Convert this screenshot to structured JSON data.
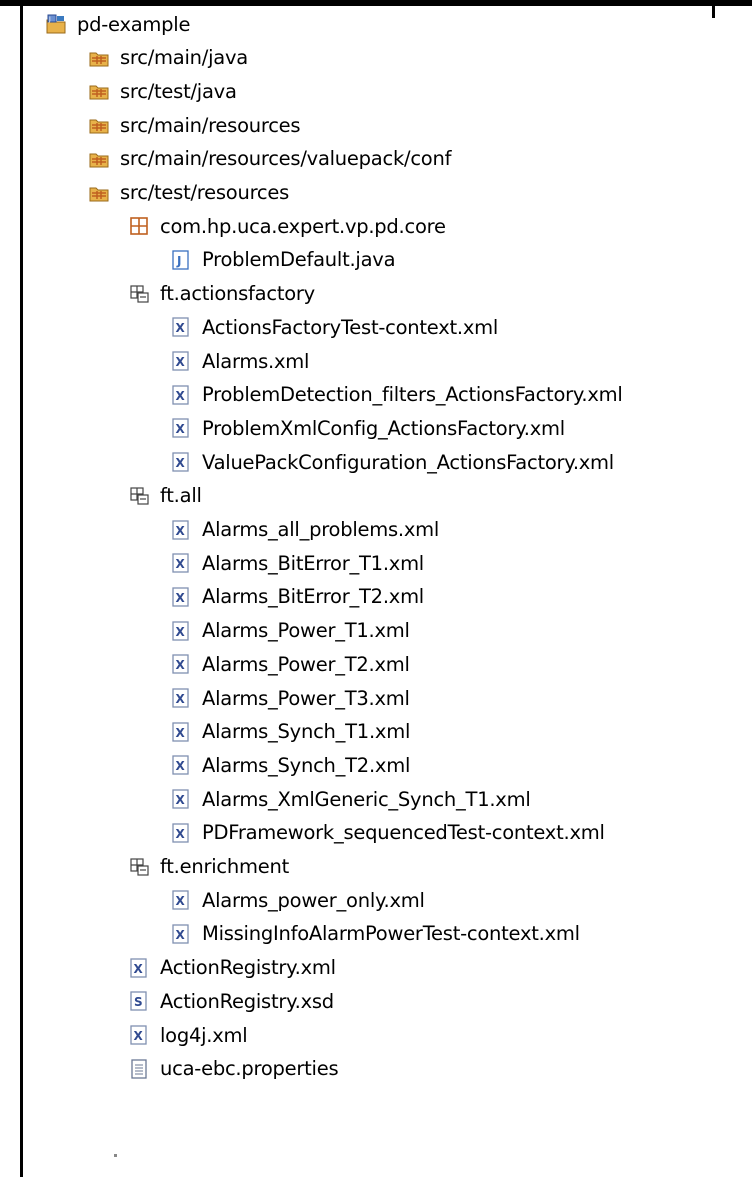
{
  "colors": {
    "folder": "#e8b24a",
    "folder_dark": "#9a6a1a",
    "package": "#c06020",
    "xml_icon": "#304a90",
    "java_icon": "#3a70c0"
  },
  "tree": [
    {
      "label": "pd-example",
      "icon": "project-icon",
      "level": 0
    },
    {
      "label": "src/main/java",
      "icon": "source-folder-icon",
      "level": 1
    },
    {
      "label": "src/test/java",
      "icon": "source-folder-icon",
      "level": 1
    },
    {
      "label": "src/main/resources",
      "icon": "source-folder-icon",
      "level": 1
    },
    {
      "label": "src/main/resources/valuepack/conf",
      "icon": "source-folder-icon",
      "level": 1
    },
    {
      "label": "src/test/resources",
      "icon": "source-folder-icon",
      "level": 1
    },
    {
      "label": "com.hp.uca.expert.vp.pd.core",
      "icon": "package-icon",
      "level": 2
    },
    {
      "label": "ProblemDefault.java",
      "icon": "java-file-icon",
      "level": 3
    },
    {
      "label": "ft.actionsfactory",
      "icon": "folder-package-icon",
      "level": 2
    },
    {
      "label": "ActionsFactoryTest-context.xml",
      "icon": "xml-file-icon",
      "level": 3
    },
    {
      "label": "Alarms.xml",
      "icon": "xml-file-icon",
      "level": 3
    },
    {
      "label": "ProblemDetection_filters_ActionsFactory.xml",
      "icon": "xml-file-icon",
      "level": 3
    },
    {
      "label": "ProblemXmlConfig_ActionsFactory.xml",
      "icon": "xml-file-icon",
      "level": 3
    },
    {
      "label": "ValuePackConfiguration_ActionsFactory.xml",
      "icon": "xml-file-icon",
      "level": 3
    },
    {
      "label": "ft.all",
      "icon": "folder-package-icon",
      "level": 2
    },
    {
      "label": "Alarms_all_problems.xml",
      "icon": "xml-file-icon",
      "level": 3
    },
    {
      "label": "Alarms_BitError_T1.xml",
      "icon": "xml-file-icon",
      "level": 3
    },
    {
      "label": "Alarms_BitError_T2.xml",
      "icon": "xml-file-icon",
      "level": 3
    },
    {
      "label": "Alarms_Power_T1.xml",
      "icon": "xml-file-icon",
      "level": 3
    },
    {
      "label": "Alarms_Power_T2.xml",
      "icon": "xml-file-icon",
      "level": 3
    },
    {
      "label": "Alarms_Power_T3.xml",
      "icon": "xml-file-icon",
      "level": 3
    },
    {
      "label": "Alarms_Synch_T1.xml",
      "icon": "xml-file-icon",
      "level": 3
    },
    {
      "label": "Alarms_Synch_T2.xml",
      "icon": "xml-file-icon",
      "level": 3
    },
    {
      "label": "Alarms_XmlGeneric_Synch_T1.xml",
      "icon": "xml-file-icon",
      "level": 3
    },
    {
      "label": "PDFramework_sequencedTest-context.xml",
      "icon": "xml-file-icon",
      "level": 3
    },
    {
      "label": "ft.enrichment",
      "icon": "folder-package-icon",
      "level": 2
    },
    {
      "label": "Alarms_power_only.xml",
      "icon": "xml-file-icon",
      "level": 3
    },
    {
      "label": "MissingInfoAlarmPowerTest-context.xml",
      "icon": "xml-file-icon",
      "level": 3
    },
    {
      "label": "ActionRegistry.xml",
      "icon": "xml-file-icon",
      "level": 2
    },
    {
      "label": "ActionRegistry.xsd",
      "icon": "xsd-file-icon",
      "level": 2
    },
    {
      "label": "log4j.xml",
      "icon": "xml-file-icon",
      "level": 2
    },
    {
      "label": "uca-ebc.properties",
      "icon": "properties-file-icon",
      "level": 2
    }
  ]
}
